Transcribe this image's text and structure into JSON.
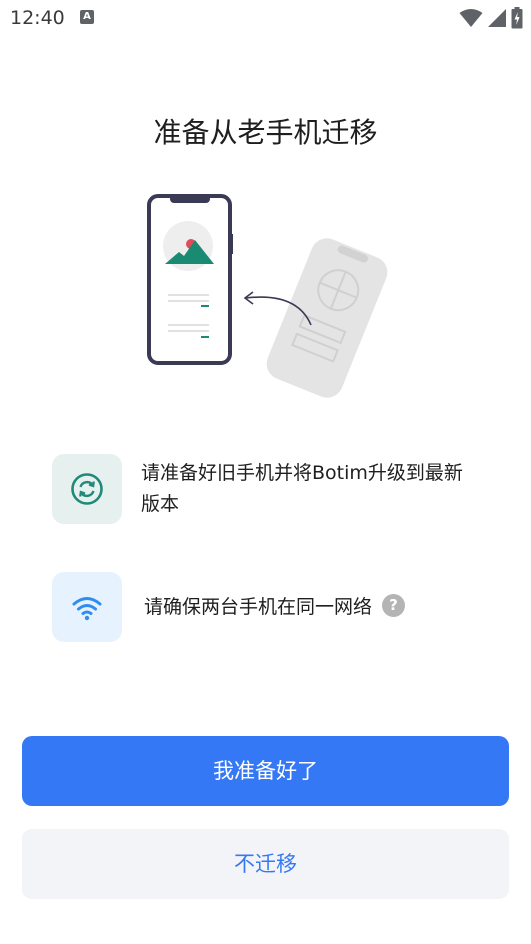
{
  "status_bar": {
    "time": "12:40",
    "notification_icon": "A",
    "icons": [
      "wifi-icon",
      "signal-icon",
      "battery-icon"
    ]
  },
  "title": "准备从老手机迁移",
  "steps": [
    {
      "icon": "sync-icon",
      "text": "请准备好旧手机并将Botim升级到最新版本",
      "icon_color": "#1f8a7a",
      "bg_color": "#e6f1ef"
    },
    {
      "icon": "wifi-icon",
      "text": "请确保两台手机在同一网络",
      "help_icon": "?",
      "icon_color": "#2f8cf0",
      "bg_color": "#e6f2fd"
    }
  ],
  "buttons": {
    "primary": "我准备好了",
    "secondary": "不迁移"
  },
  "colors": {
    "accent": "#3478f6",
    "secondary_bg": "#f3f4f8",
    "illustration_teal": "#1a8a73",
    "illustration_frame": "#3b3a55"
  }
}
